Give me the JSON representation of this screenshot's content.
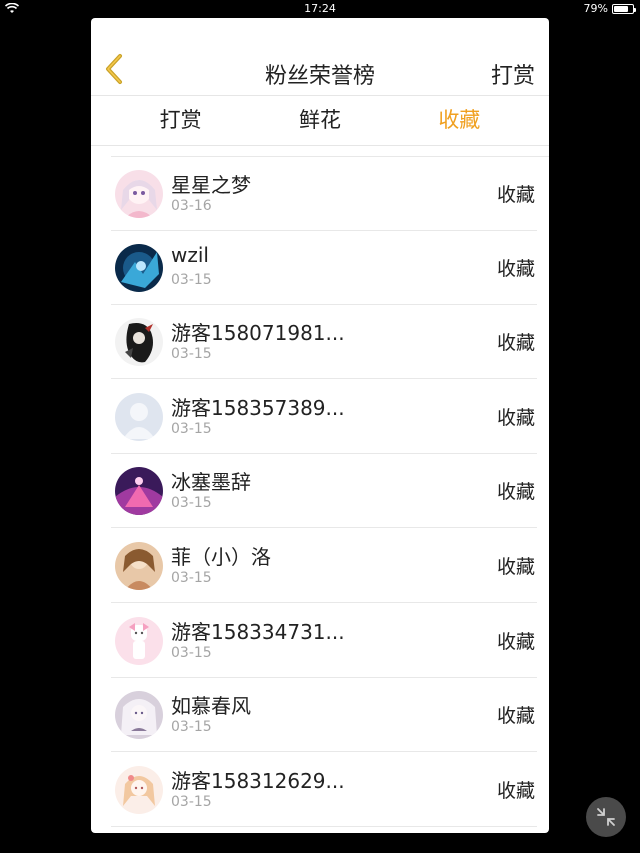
{
  "status_bar": {
    "time": "17:24",
    "battery": "79%",
    "battery_level": 0.79
  },
  "header": {
    "title": "粉丝荣誉榜",
    "right_button": "打赏",
    "back_icon": "chevron-left-icon",
    "accent_color": "#f0a020"
  },
  "tabs": [
    {
      "label": "打赏",
      "active": false
    },
    {
      "label": "鲜花",
      "active": false
    },
    {
      "label": "收藏",
      "active": true
    }
  ],
  "list": [
    {
      "name": "星星之梦",
      "date": "03-16",
      "action": "收藏"
    },
    {
      "name": "wzil",
      "date": "03-15",
      "action": "收藏"
    },
    {
      "name": "游客158071981...",
      "date": "03-15",
      "action": "收藏"
    },
    {
      "name": "游客158357389...",
      "date": "03-15",
      "action": "收藏"
    },
    {
      "name": "冰塞墨辞",
      "date": "03-15",
      "action": "收藏"
    },
    {
      "name": "菲（小）洛",
      "date": "03-15",
      "action": "收藏"
    },
    {
      "name": "游客158334731...",
      "date": "03-15",
      "action": "收藏"
    },
    {
      "name": "如慕春风",
      "date": "03-15",
      "action": "收藏"
    },
    {
      "name": "游客158312629...",
      "date": "03-15",
      "action": "收藏"
    }
  ],
  "float_button": {
    "icon": "collapse-arrows-icon"
  }
}
